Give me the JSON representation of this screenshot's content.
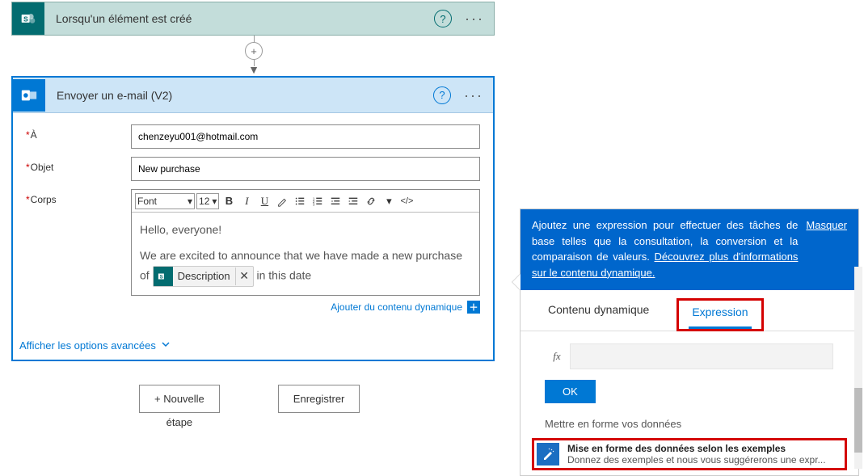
{
  "trigger": {
    "title": "Lorsqu'un élément est créé"
  },
  "action": {
    "title": "Envoyer un e-mail (V2)"
  },
  "fields": {
    "to_label": "À",
    "to_value": "chenzeyu001@hotmail.com",
    "subject_label": "Objet",
    "subject_value": "New purchase",
    "body_label": "Corps"
  },
  "rte": {
    "font_label": "Font",
    "size_label": "12",
    "body_line1": "Hello, everyone!",
    "body_line2a": "We are excited to announce that we have made a new purchase of",
    "token_label": "Description",
    "body_line2b": "in this date"
  },
  "links": {
    "add_dynamic": "Ajouter du contenu dynamique",
    "advanced": "Afficher les options avancées"
  },
  "buttons": {
    "new_step_top": "+ Nouvelle",
    "new_step_bottom": "étape",
    "save": "Enregistrer"
  },
  "panel": {
    "banner_text": "Ajoutez une expression pour effectuer des tâches de base telles que la consultation, la conversion et la comparaison de valeurs. ",
    "banner_link": "Découvrez plus d'informations sur le contenu dynamique.",
    "mask": "Masquer",
    "tab_dynamic": "Contenu dynamique",
    "tab_expression": "Expression",
    "fx": "fx",
    "ok": "OK",
    "section": "Mettre en forme vos données",
    "example_title": "Mise en forme des données selon les exemples",
    "example_sub": "Donnez des exemples et nous vous suggérerons une expr..."
  }
}
